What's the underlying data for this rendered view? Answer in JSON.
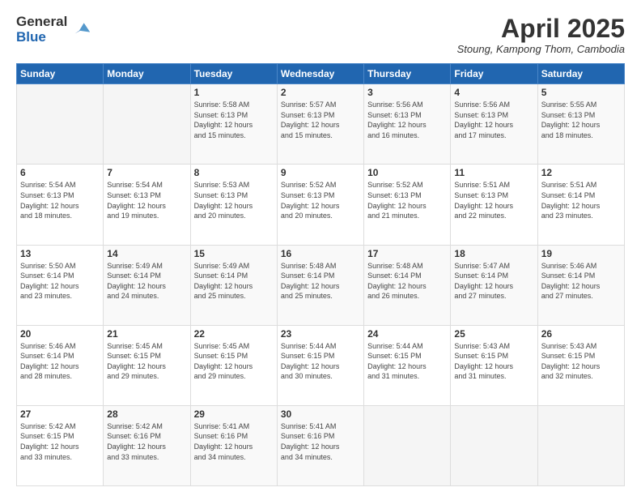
{
  "logo": {
    "general": "General",
    "blue": "Blue"
  },
  "title": {
    "month": "April 2025",
    "location": "Stoung, Kampong Thom, Cambodia"
  },
  "weekdays": [
    "Sunday",
    "Monday",
    "Tuesday",
    "Wednesday",
    "Thursday",
    "Friday",
    "Saturday"
  ],
  "weeks": [
    [
      {
        "day": "",
        "info": ""
      },
      {
        "day": "",
        "info": ""
      },
      {
        "day": "1",
        "info": "Sunrise: 5:58 AM\nSunset: 6:13 PM\nDaylight: 12 hours\nand 15 minutes."
      },
      {
        "day": "2",
        "info": "Sunrise: 5:57 AM\nSunset: 6:13 PM\nDaylight: 12 hours\nand 15 minutes."
      },
      {
        "day": "3",
        "info": "Sunrise: 5:56 AM\nSunset: 6:13 PM\nDaylight: 12 hours\nand 16 minutes."
      },
      {
        "day": "4",
        "info": "Sunrise: 5:56 AM\nSunset: 6:13 PM\nDaylight: 12 hours\nand 17 minutes."
      },
      {
        "day": "5",
        "info": "Sunrise: 5:55 AM\nSunset: 6:13 PM\nDaylight: 12 hours\nand 18 minutes."
      }
    ],
    [
      {
        "day": "6",
        "info": "Sunrise: 5:54 AM\nSunset: 6:13 PM\nDaylight: 12 hours\nand 18 minutes."
      },
      {
        "day": "7",
        "info": "Sunrise: 5:54 AM\nSunset: 6:13 PM\nDaylight: 12 hours\nand 19 minutes."
      },
      {
        "day": "8",
        "info": "Sunrise: 5:53 AM\nSunset: 6:13 PM\nDaylight: 12 hours\nand 20 minutes."
      },
      {
        "day": "9",
        "info": "Sunrise: 5:52 AM\nSunset: 6:13 PM\nDaylight: 12 hours\nand 20 minutes."
      },
      {
        "day": "10",
        "info": "Sunrise: 5:52 AM\nSunset: 6:13 PM\nDaylight: 12 hours\nand 21 minutes."
      },
      {
        "day": "11",
        "info": "Sunrise: 5:51 AM\nSunset: 6:13 PM\nDaylight: 12 hours\nand 22 minutes."
      },
      {
        "day": "12",
        "info": "Sunrise: 5:51 AM\nSunset: 6:14 PM\nDaylight: 12 hours\nand 23 minutes."
      }
    ],
    [
      {
        "day": "13",
        "info": "Sunrise: 5:50 AM\nSunset: 6:14 PM\nDaylight: 12 hours\nand 23 minutes."
      },
      {
        "day": "14",
        "info": "Sunrise: 5:49 AM\nSunset: 6:14 PM\nDaylight: 12 hours\nand 24 minutes."
      },
      {
        "day": "15",
        "info": "Sunrise: 5:49 AM\nSunset: 6:14 PM\nDaylight: 12 hours\nand 25 minutes."
      },
      {
        "day": "16",
        "info": "Sunrise: 5:48 AM\nSunset: 6:14 PM\nDaylight: 12 hours\nand 25 minutes."
      },
      {
        "day": "17",
        "info": "Sunrise: 5:48 AM\nSunset: 6:14 PM\nDaylight: 12 hours\nand 26 minutes."
      },
      {
        "day": "18",
        "info": "Sunrise: 5:47 AM\nSunset: 6:14 PM\nDaylight: 12 hours\nand 27 minutes."
      },
      {
        "day": "19",
        "info": "Sunrise: 5:46 AM\nSunset: 6:14 PM\nDaylight: 12 hours\nand 27 minutes."
      }
    ],
    [
      {
        "day": "20",
        "info": "Sunrise: 5:46 AM\nSunset: 6:14 PM\nDaylight: 12 hours\nand 28 minutes."
      },
      {
        "day": "21",
        "info": "Sunrise: 5:45 AM\nSunset: 6:15 PM\nDaylight: 12 hours\nand 29 minutes."
      },
      {
        "day": "22",
        "info": "Sunrise: 5:45 AM\nSunset: 6:15 PM\nDaylight: 12 hours\nand 29 minutes."
      },
      {
        "day": "23",
        "info": "Sunrise: 5:44 AM\nSunset: 6:15 PM\nDaylight: 12 hours\nand 30 minutes."
      },
      {
        "day": "24",
        "info": "Sunrise: 5:44 AM\nSunset: 6:15 PM\nDaylight: 12 hours\nand 31 minutes."
      },
      {
        "day": "25",
        "info": "Sunrise: 5:43 AM\nSunset: 6:15 PM\nDaylight: 12 hours\nand 31 minutes."
      },
      {
        "day": "26",
        "info": "Sunrise: 5:43 AM\nSunset: 6:15 PM\nDaylight: 12 hours\nand 32 minutes."
      }
    ],
    [
      {
        "day": "27",
        "info": "Sunrise: 5:42 AM\nSunset: 6:15 PM\nDaylight: 12 hours\nand 33 minutes."
      },
      {
        "day": "28",
        "info": "Sunrise: 5:42 AM\nSunset: 6:16 PM\nDaylight: 12 hours\nand 33 minutes."
      },
      {
        "day": "29",
        "info": "Sunrise: 5:41 AM\nSunset: 6:16 PM\nDaylight: 12 hours\nand 34 minutes."
      },
      {
        "day": "30",
        "info": "Sunrise: 5:41 AM\nSunset: 6:16 PM\nDaylight: 12 hours\nand 34 minutes."
      },
      {
        "day": "",
        "info": ""
      },
      {
        "day": "",
        "info": ""
      },
      {
        "day": "",
        "info": ""
      }
    ]
  ]
}
